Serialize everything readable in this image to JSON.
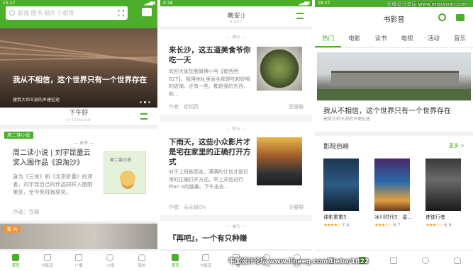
{
  "p1": {
    "status_time": "15:27",
    "search_placeholder": "影视 图书 唱片 小组等",
    "hero_title": "我从不相信，这个世界只有一个世界存在",
    "hero_sub": "建筑大师王澍的乡建征途",
    "logo": "下午好",
    "logo_sub": "AFTERNOON",
    "card_tag": "周二读小说",
    "card_kicker": "— 读书 —",
    "card_title": "周二读小说 | 刘宇昆量云奖入围作品《浪淘沙》",
    "card_body": "身为《三体》和《北京折叠》的译者，刘宇昆自己的作品同样入围雨果奖，至今笑拜我获奖。",
    "card_img_text": "周二读小说",
    "card_author": "作者：豆瓣",
    "tag2": "影 片",
    "tabs": [
      "首页",
      "书影音",
      "广播",
      "小组",
      "我的"
    ]
  },
  "p2": {
    "status_time": "0:18",
    "logo": "晚安:)",
    "logo_sub": "NIGHT",
    "sec1": "— 旅行 —",
    "card1_title": "来长沙，这五道美食爷你吃一天",
    "card1_body": "欢迎大家加我微博小号【崔西西627】，我博地址里面全部是吃和好喝的店铺，还有一些，都是我的东西，和...",
    "card1_author": "作者：崔相西",
    "card1_source": "豆瓣猫",
    "sec2": "— 影行 —",
    "card2_title": "下雨天，这些小众影片才是宅在家里的正确打开方式",
    "card2_body": "对于上班族而言，满满的计划才是日常的正确打开方式。早上开始进行Plan A的脑暴。下午出去...",
    "card2_author": "作者：朵朵最Oh",
    "card2_source": "豆瓣猫",
    "sec3": "— 旅行 —",
    "card3_title": "『再吧』，一个有只种赚",
    "tabs": [
      "首页",
      "书影音",
      "广播",
      "小组",
      "我的"
    ]
  },
  "p3": {
    "status_time": "16:27",
    "watermark": "思缘设计论坛 www.missyuan.com",
    "title": "书影音",
    "tabs": [
      "热门",
      "电影",
      "读书",
      "电视",
      "活动",
      "音乐"
    ],
    "hero_title": "我从不相信，这个世界只有一个世界存在",
    "hero_sub": "建筑大师王澍的乡建征途",
    "movies_header": "影院热映",
    "more": "更多 >",
    "movies": [
      {
        "title": "谍影重重5",
        "rating": "7.4",
        "stars": "★★★★☆"
      },
      {
        "title": "冰川时代5：星...",
        "rating": "6.7",
        "stars": "★★★☆☆"
      },
      {
        "title": "使徒行者",
        "rating": "6.9",
        "stars": "★★★☆☆"
      }
    ]
  },
  "footer_watermark": "平面设计论坛 www.lineeg.com/tieba/1822",
  "colors": {
    "accent": "#4cae2a",
    "orange": "#f09433"
  }
}
